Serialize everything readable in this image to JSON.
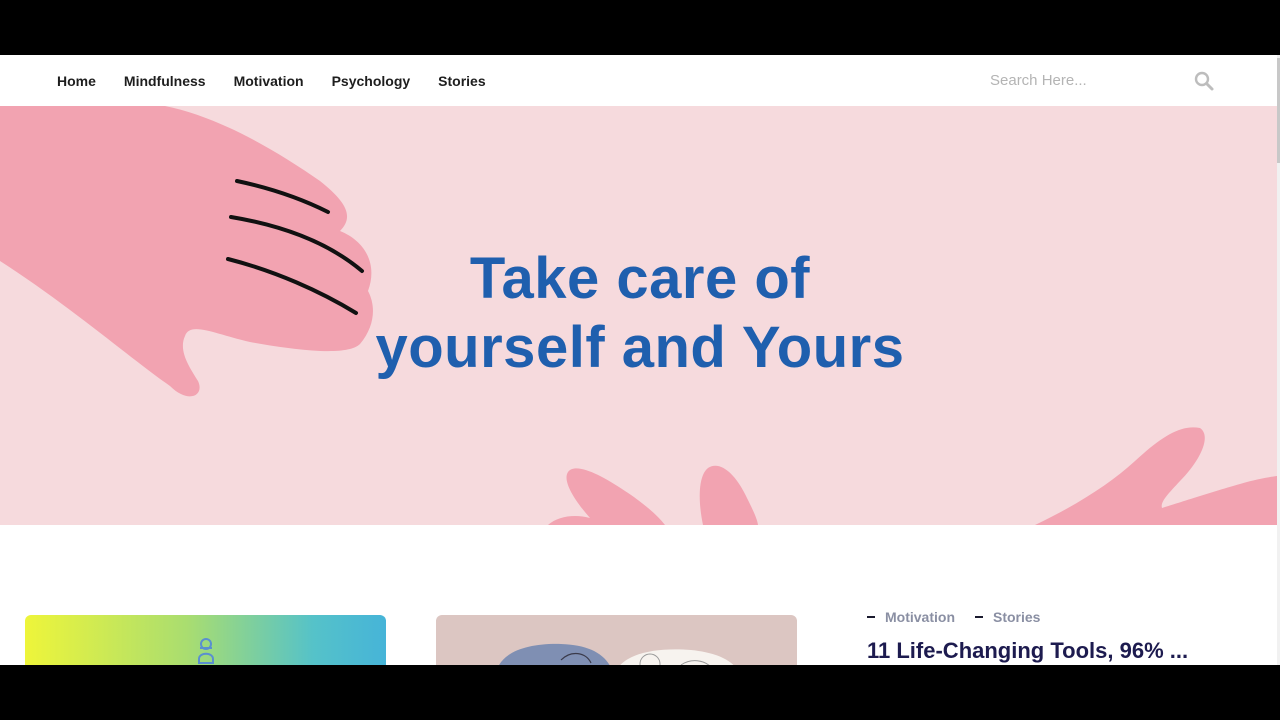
{
  "nav": {
    "items": [
      {
        "label": "Home"
      },
      {
        "label": "Mindfulness"
      },
      {
        "label": "Motivation"
      },
      {
        "label": "Psychology"
      },
      {
        "label": "Stories"
      }
    ],
    "search_placeholder": "Search Here...",
    "search_icon": "search-icon"
  },
  "hero": {
    "title_line1": "Take care of",
    "title_line2": "yourself and Yours",
    "colors": {
      "background": "#f6dadd",
      "hand": "#f2a3b1",
      "title": "#1f5fae"
    }
  },
  "featured_post": {
    "categories": [
      "Motivation",
      "Stories"
    ],
    "title": "11 Life-Changing Tools, 96% ..."
  },
  "colors": {
    "post_title": "#1d1b4f",
    "category": "#8a8fa3"
  }
}
